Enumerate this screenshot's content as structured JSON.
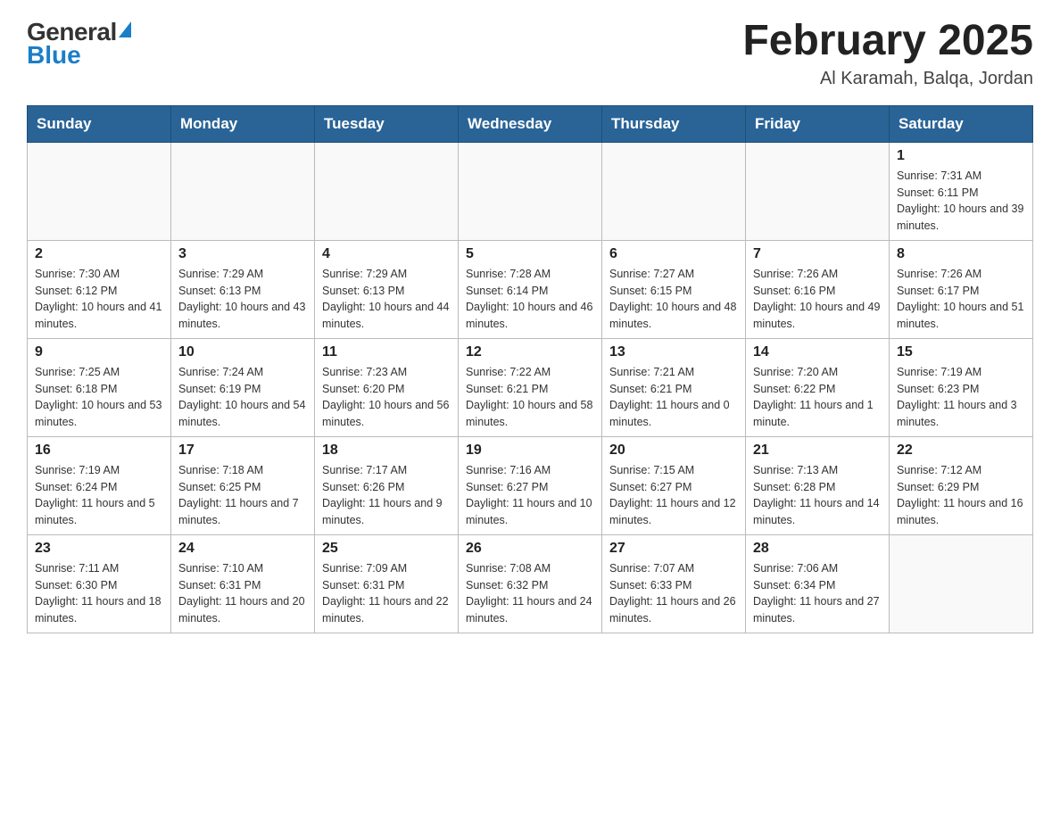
{
  "logo": {
    "general": "General",
    "blue": "Blue",
    "triangle_char": "▲"
  },
  "title": "February 2025",
  "subtitle": "Al Karamah, Balqa, Jordan",
  "header_days": [
    "Sunday",
    "Monday",
    "Tuesday",
    "Wednesday",
    "Thursday",
    "Friday",
    "Saturday"
  ],
  "weeks": [
    [
      {
        "day": "",
        "info": ""
      },
      {
        "day": "",
        "info": ""
      },
      {
        "day": "",
        "info": ""
      },
      {
        "day": "",
        "info": ""
      },
      {
        "day": "",
        "info": ""
      },
      {
        "day": "",
        "info": ""
      },
      {
        "day": "1",
        "info": "Sunrise: 7:31 AM\nSunset: 6:11 PM\nDaylight: 10 hours and 39 minutes."
      }
    ],
    [
      {
        "day": "2",
        "info": "Sunrise: 7:30 AM\nSunset: 6:12 PM\nDaylight: 10 hours and 41 minutes."
      },
      {
        "day": "3",
        "info": "Sunrise: 7:29 AM\nSunset: 6:13 PM\nDaylight: 10 hours and 43 minutes."
      },
      {
        "day": "4",
        "info": "Sunrise: 7:29 AM\nSunset: 6:13 PM\nDaylight: 10 hours and 44 minutes."
      },
      {
        "day": "5",
        "info": "Sunrise: 7:28 AM\nSunset: 6:14 PM\nDaylight: 10 hours and 46 minutes."
      },
      {
        "day": "6",
        "info": "Sunrise: 7:27 AM\nSunset: 6:15 PM\nDaylight: 10 hours and 48 minutes."
      },
      {
        "day": "7",
        "info": "Sunrise: 7:26 AM\nSunset: 6:16 PM\nDaylight: 10 hours and 49 minutes."
      },
      {
        "day": "8",
        "info": "Sunrise: 7:26 AM\nSunset: 6:17 PM\nDaylight: 10 hours and 51 minutes."
      }
    ],
    [
      {
        "day": "9",
        "info": "Sunrise: 7:25 AM\nSunset: 6:18 PM\nDaylight: 10 hours and 53 minutes."
      },
      {
        "day": "10",
        "info": "Sunrise: 7:24 AM\nSunset: 6:19 PM\nDaylight: 10 hours and 54 minutes."
      },
      {
        "day": "11",
        "info": "Sunrise: 7:23 AM\nSunset: 6:20 PM\nDaylight: 10 hours and 56 minutes."
      },
      {
        "day": "12",
        "info": "Sunrise: 7:22 AM\nSunset: 6:21 PM\nDaylight: 10 hours and 58 minutes."
      },
      {
        "day": "13",
        "info": "Sunrise: 7:21 AM\nSunset: 6:21 PM\nDaylight: 11 hours and 0 minutes."
      },
      {
        "day": "14",
        "info": "Sunrise: 7:20 AM\nSunset: 6:22 PM\nDaylight: 11 hours and 1 minute."
      },
      {
        "day": "15",
        "info": "Sunrise: 7:19 AM\nSunset: 6:23 PM\nDaylight: 11 hours and 3 minutes."
      }
    ],
    [
      {
        "day": "16",
        "info": "Sunrise: 7:19 AM\nSunset: 6:24 PM\nDaylight: 11 hours and 5 minutes."
      },
      {
        "day": "17",
        "info": "Sunrise: 7:18 AM\nSunset: 6:25 PM\nDaylight: 11 hours and 7 minutes."
      },
      {
        "day": "18",
        "info": "Sunrise: 7:17 AM\nSunset: 6:26 PM\nDaylight: 11 hours and 9 minutes."
      },
      {
        "day": "19",
        "info": "Sunrise: 7:16 AM\nSunset: 6:27 PM\nDaylight: 11 hours and 10 minutes."
      },
      {
        "day": "20",
        "info": "Sunrise: 7:15 AM\nSunset: 6:27 PM\nDaylight: 11 hours and 12 minutes."
      },
      {
        "day": "21",
        "info": "Sunrise: 7:13 AM\nSunset: 6:28 PM\nDaylight: 11 hours and 14 minutes."
      },
      {
        "day": "22",
        "info": "Sunrise: 7:12 AM\nSunset: 6:29 PM\nDaylight: 11 hours and 16 minutes."
      }
    ],
    [
      {
        "day": "23",
        "info": "Sunrise: 7:11 AM\nSunset: 6:30 PM\nDaylight: 11 hours and 18 minutes."
      },
      {
        "day": "24",
        "info": "Sunrise: 7:10 AM\nSunset: 6:31 PM\nDaylight: 11 hours and 20 minutes."
      },
      {
        "day": "25",
        "info": "Sunrise: 7:09 AM\nSunset: 6:31 PM\nDaylight: 11 hours and 22 minutes."
      },
      {
        "day": "26",
        "info": "Sunrise: 7:08 AM\nSunset: 6:32 PM\nDaylight: 11 hours and 24 minutes."
      },
      {
        "day": "27",
        "info": "Sunrise: 7:07 AM\nSunset: 6:33 PM\nDaylight: 11 hours and 26 minutes."
      },
      {
        "day": "28",
        "info": "Sunrise: 7:06 AM\nSunset: 6:34 PM\nDaylight: 11 hours and 27 minutes."
      },
      {
        "day": "",
        "info": ""
      }
    ]
  ]
}
